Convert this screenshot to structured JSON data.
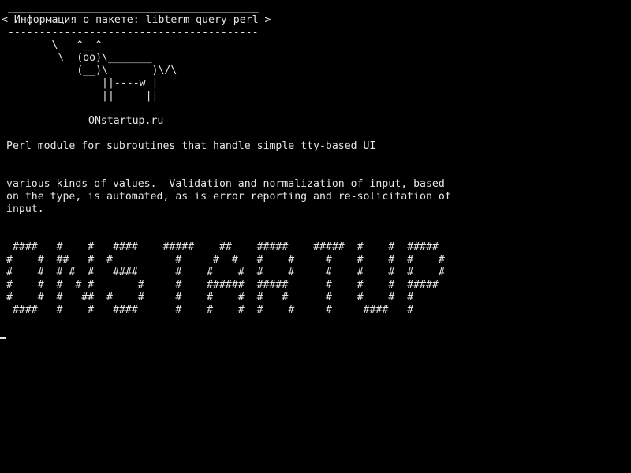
{
  "screen": {
    "background": "#000000",
    "foreground": "#e6e6e6"
  },
  "speech_bubble": {
    "top_border": " ________________________________________",
    "text": "< Информация о пакете: libterm-query-perl >",
    "bottom_border": " ----------------------------------------"
  },
  "cow_ascii": "        \\   ^__^\n         \\  (oo)\\_______\n            (__)\\       )\\/\\\n                ||----w |\n                ||     ||",
  "site": "ONstartup.ru",
  "package_summary": "Perl module for subroutines that handle simple tty-based UI",
  "package_description": "various kinds of values.  Validation and normalization of input, based\non the type, is automated, as is error reporting and re-solicitation of\ninput.",
  "banner_ascii": " ####   #    #   ####    #####    ##    #####    #####  #    #  #####\n#    #  ##   #  #          #     #  #   #    #     #    #    #  #    #\n#    #  # #  #   ####      #    #    #  #    #     #    #    #  #    #\n#    #  #  # #       #     #    ######  #####      #    #    #  #####\n#    #  #   ##  #    #     #    #    #  #   #      #    #    #  #\n ####   #    #   ####      #    #    #  #    #     #     ####   #",
  "cursor": "_"
}
